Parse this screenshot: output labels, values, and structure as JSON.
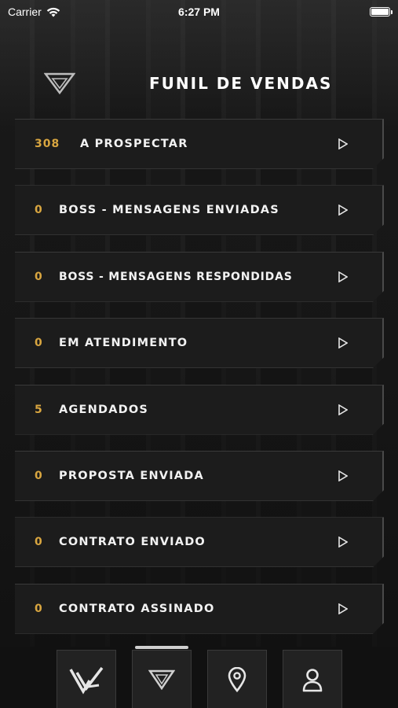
{
  "status_bar": {
    "carrier": "Carrier",
    "time": "6:27 PM"
  },
  "header": {
    "title": "FUNIL DE VENDAS",
    "logo_icon": "funnel-triangle-icon"
  },
  "stages": [
    {
      "count": "308",
      "name": "A PROSPECTAR"
    },
    {
      "count": "0",
      "name": "BOSS - MENSAGENS ENVIADAS"
    },
    {
      "count": "0",
      "name": "BOSS - MENSAGENS RESPONDIDAS"
    },
    {
      "count": "0",
      "name": "EM ATENDIMENTO"
    },
    {
      "count": "5",
      "name": "AGENDADOS"
    },
    {
      "count": "0",
      "name": "PROPOSTA ENVIADA"
    },
    {
      "count": "0",
      "name": "CONTRATO ENVIADO"
    },
    {
      "count": "0",
      "name": "CONTRATO ASSINADO"
    }
  ],
  "tabbar": {
    "tabs": [
      {
        "icon": "brand-logo-icon",
        "active": false
      },
      {
        "icon": "funnel-icon",
        "active": true
      },
      {
        "icon": "map-pin-icon",
        "active": false
      },
      {
        "icon": "user-icon",
        "active": false
      }
    ]
  },
  "colors": {
    "accent": "#d9a640",
    "card": "#1c1c1c",
    "text": "#f2f2f2"
  }
}
